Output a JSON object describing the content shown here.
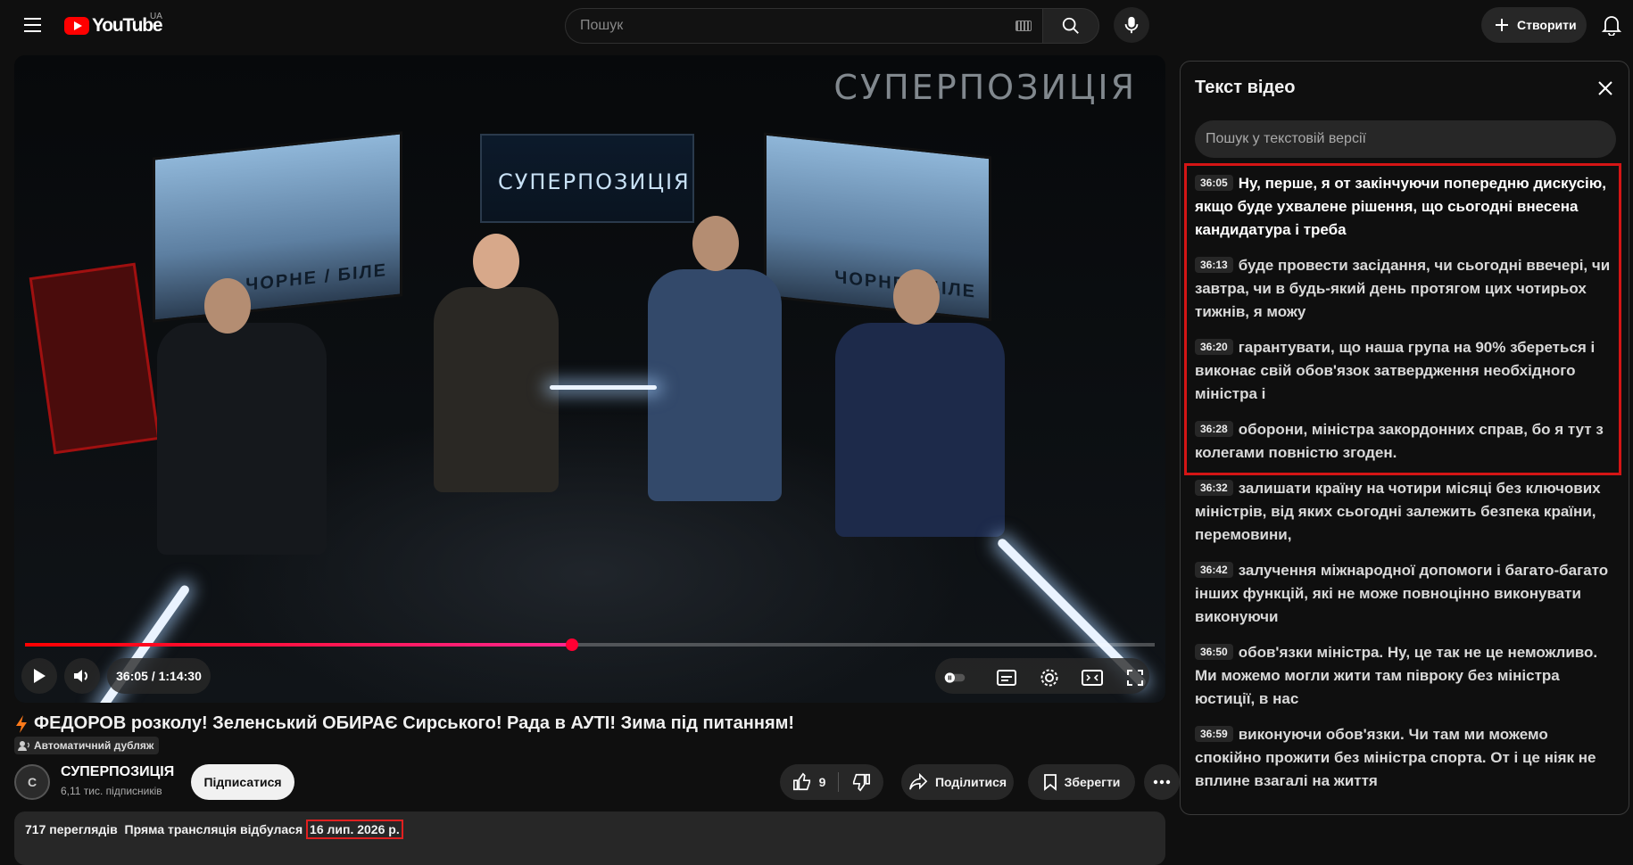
{
  "header": {
    "logo_text": "YouTube",
    "region": "UA",
    "search_placeholder": "Пошук",
    "create_label": "Створити"
  },
  "player": {
    "watermark": "СУПЕРПОЗИЦІЯ",
    "studio_sign": "СУПЕРПОЗИЦІЯ",
    "screen_caption_left": "ЧОРНЕ / БІЛЕ",
    "screen_caption_right": "ЧОРНЕ / БІЛЕ",
    "time_display": "36:05 / 1:14:30",
    "progress_fraction": 0.484
  },
  "video": {
    "title": "ФЕДОРОВ розколу! Зеленський ОБИРАЄ Сирського! Рада в АУТІ! Зима під питанням!",
    "dub_label": "Автоматичний дубляж",
    "channel_name": "СУПЕРПОЗИЦІЯ",
    "channel_subs": "6,11 тис. підписників",
    "avatar_letter": "С",
    "subscribe_label": "Підписатися",
    "likes": "9",
    "share_label": "Поділитися",
    "save_label": "Зберегти",
    "views": "717 переглядів",
    "stream_label": "Пряма трансляція відбулася",
    "date": "16 лип. 2026 р."
  },
  "transcript": {
    "title": "Текст відео",
    "search_placeholder": "Пошук у текстовій версії",
    "segments": [
      {
        "time": "36:05",
        "text": "Ну, перше, я от закінчуючи попередню дискусію, якщо буде ухвалене рішення, що сьогодні внесена кандидатура і треба"
      },
      {
        "time": "36:13",
        "text": "буде провести засідання, чи сьогодні ввечері, чи завтра, чи в будь-який день протягом цих чотирьох тижнів, я можу"
      },
      {
        "time": "36:20",
        "text": "гарантувати, що наша група на 90% збереться і виконає свій обов'язок затвердження необхідного міністра і"
      },
      {
        "time": "36:28",
        "text": "оборони, міністра закордонних справ, бо я тут з колегами повністю згоден."
      },
      {
        "time": "36:32",
        "text": "залишати країну на чотири місяці без ключових міністрів, від яких сьогодні залежить безпека країни, перемовини,"
      },
      {
        "time": "36:42",
        "text": "залучення міжнародної допомоги і багато-багато інших функцій, які не може повноцінно виконувати виконуючи"
      },
      {
        "time": "36:50",
        "text": "обов'язки міністра. Ну, це так не це неможливо. Ми можемо могли жити там півроку без міністра юстиції, в нас"
      },
      {
        "time": "36:59",
        "text": "виконуючи обов'язки. Чи там ми можемо спокійно прожити без міністра спорта. От і це ніяк не вплине взагалі на життя"
      }
    ]
  },
  "colors": {
    "accent_red": "#ff0000",
    "highlight_box": "#d41515",
    "progress": "#ff0033"
  }
}
